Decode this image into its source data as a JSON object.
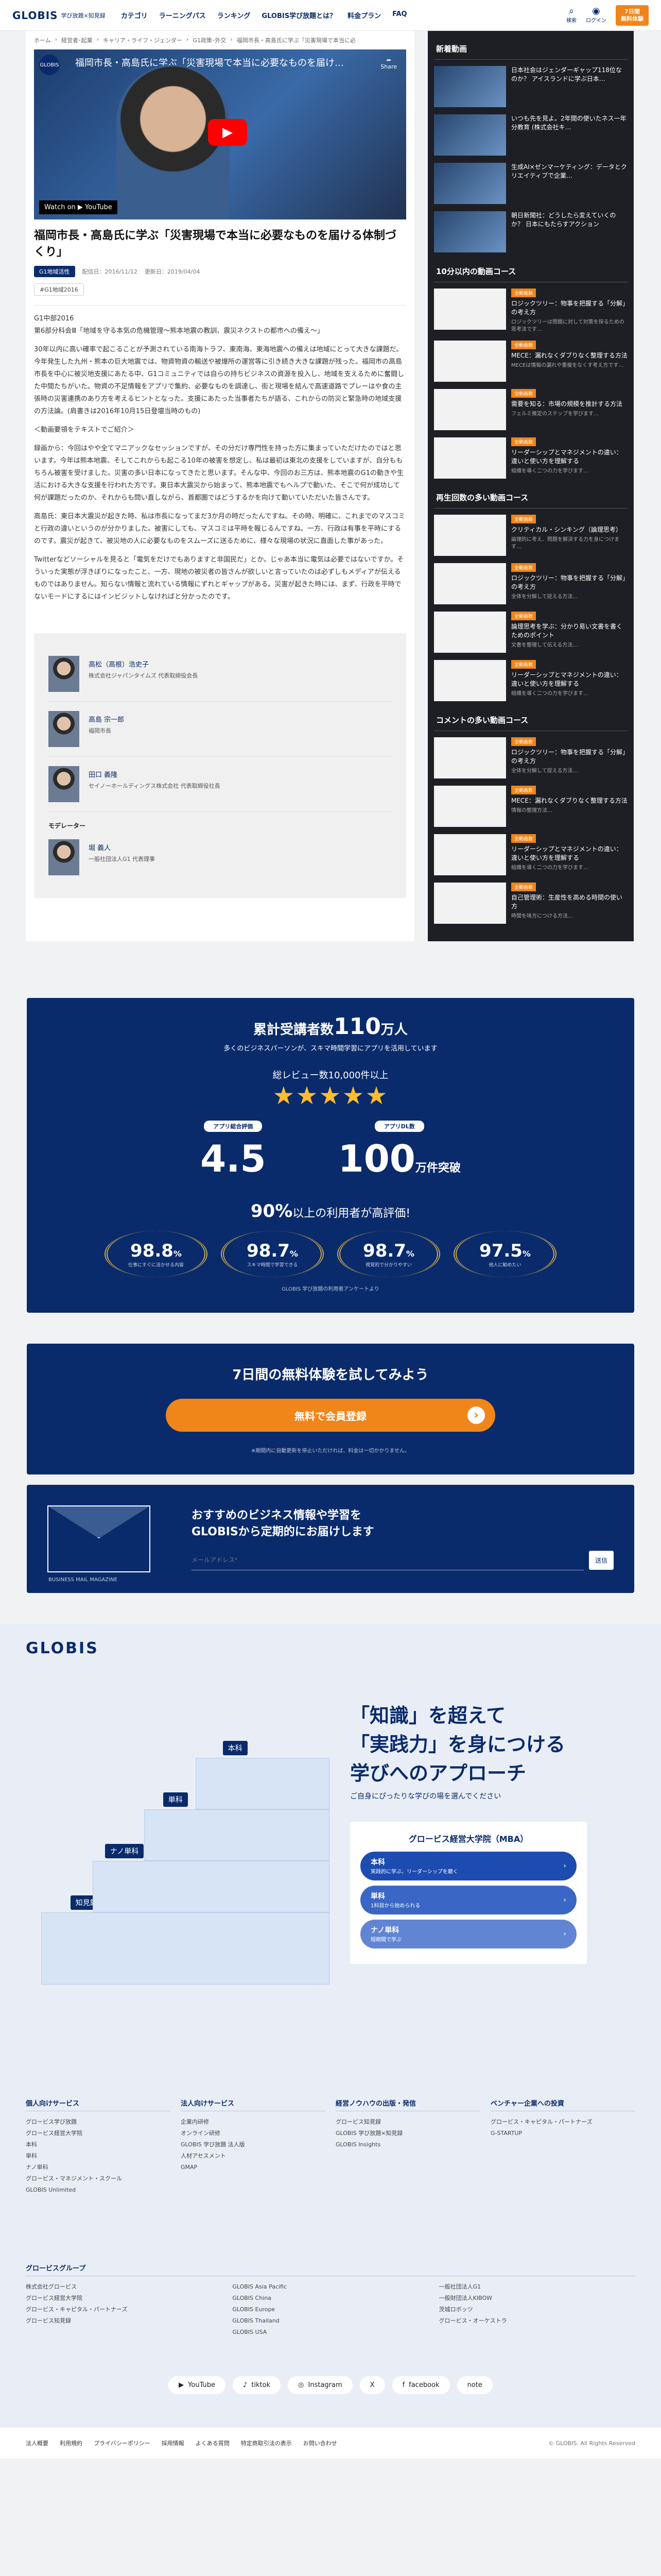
{
  "header": {
    "logo": "GLOBIS",
    "logo_sub": "学び放題×知見録",
    "nav": [
      "カテゴリ",
      "ラーニングパス",
      "ランキング",
      "GLOBIS学び放題とは？",
      "料金プラン",
      "FAQ"
    ],
    "icons": [
      {
        "glyph": "⌕",
        "label": "検索"
      },
      {
        "glyph": "◉",
        "label": "ログイン"
      }
    ],
    "trial_line1": "7日間",
    "trial_line2": "無料体験"
  },
  "breadcrumb": [
    "ホーム",
    "経営者･起業",
    "キャリア・ライフ・ジェンダー",
    "G1政策･外交",
    "福岡市長・高島氏に学ぶ「災害現場で本当に必要なものを届ける体制づくり」"
  ],
  "video": {
    "channel": "GLOBIS",
    "title": "福岡市長・高島氏に学ぶ「災害現場で本当に必要なものを届け…",
    "share": "Share",
    "watch": "Watch on ▶ YouTube"
  },
  "article": {
    "title": "福岡市長・高島氏に学ぶ「災害現場で本当に必要なものを届ける体制づくり」",
    "tag": "G1地域活性",
    "published": "配信日：2016/11/12",
    "updated": "更新日：2019/04/04",
    "subtag": "#G1地域2016",
    "paragraphs": [
      "G1中部2016\n第6部分科会Ⅲ「地域を守る本気の危機管理～熊本地震の教訓、震災ネクストの都市への備え～」",
      "30年以内に高い確率で起こることが予測されている南海トラフ、東南海、東海地震への備えは地域にとって大きな課題だ。今年発生した九州・熊本の巨大地震では、物資物資の輸送や被爆所の運営等に引き続き大きな課題が残った。福岡市の高島市長を中心に被災地支援にあたる中、G1コミュニティでは自らの持ちビジネスの資源を投入し、地域を支えるために奮闘した中間たちがいた。物資の不足情報をアプリで集約、必要なものを調達し、街と現場を結んで高速道路でプレーはや食の主張時の災害連携のあり方を考えるヒントとなった。支援にあたった当事者たちが語る、これからの防災と緊急時の地域支援の方法論。(肩書きは2016年10月15日登壇当時のもの)",
      "＜動画要領をテキストでご紹介＞",
      "録画から：今回はやや全てマニアックなセッションですが、その分だけ専門性を持った方に集まっていただけたのではと思います。今年は熊本地震、そしてこれからも起こる10年の被害を想定し、私は最初は東北の支援をしていますが、自分ももちろん被害を受けました。災害の多い日本になってきたと思います。そんな中、今回のお三方は、熊本地震のG1の動きや生活における大きな支援を行われた方です。東日本大震災から始まって、熊本地震でもヘルプで動いた、そこで何が成功して何が課題だったのか、それからも問い直しながら、首都圏ではどうするかを向けて動いていただいた皆さんです。",
      "高島氏：東日本大震災が起きた時、私は市長になってまだ3か月の時だったんですね。その時、明確に、これまでのマスコミと行政の違いというのが分かりました。被害にしても、マスコミは平時を報じるんですね。一方、行政は有事を平時にするのです。震災が起きて、被災地の人に必要なものをスムーズに送るために、様々な現場の状況に直面した事があった。",
      "Twitterなどソーシャルを見ると「電気をだけでもありますと非国民だ」とか。じゃあ本当に電気は必要ではないですか。そういった実態が浮きぼりになったこと、一方、現地の被災者の皆さんが欲しいと言っていたのは必ずしもメディアが伝えるものではありません。知らない情報と流れている情報にずれとギャップがある。災害が起きた時には、まず、行政を平時でないモードにするにはインビジットしなければと分かったのです。"
    ]
  },
  "speakers": [
    {
      "name": "高松（高根）浩史子",
      "role": "株式会社ジャパンタイムズ 代表取締役会長"
    },
    {
      "name": "高島 宗一郎",
      "role": "福岡市長"
    },
    {
      "name": "田口 義隆",
      "role": "セイノーホールディングス株式会社 代表取締役社長"
    }
  ],
  "moderator_label": "モデレーター",
  "moderator": {
    "name": "堀 義人",
    "role": "一般社団法人G1 代表理事"
  },
  "sidebar": {
    "new_heading": "新着動画",
    "new_items": [
      {
        "title": "日本社会はジェンダーギャップ118位なのか？ アイスランドに学ぶ日本…"
      },
      {
        "title": "いつも先を見よ。2年間の使いたネス一年分教育 (株式会社キ…"
      },
      {
        "title": "生成AI×ゼンマーケティング：データとクリエイティブで企業…"
      },
      {
        "title": "朝日新聞社：どうしたら変えていくのか？ 日本にもたらすアクション"
      }
    ],
    "short_heading": "10分以内の動画コース",
    "short_items": [
      {
        "badge": "全動画数",
        "title": "ロジックツリー：物事を把握する「分解」の考え方",
        "desc": "ロジックツリーは問題に対して対策を探るための思考法です…"
      },
      {
        "badge": "全動画数",
        "title": "MECE：漏れなくダブりなく整理する方法",
        "desc": "MECEは情報の漏れや重複をなくす考え方です…"
      },
      {
        "badge": "全動画数",
        "title": "需要を知る：市場の規模を推計する方法",
        "desc": "フェルミ推定のステップを学びます…"
      },
      {
        "badge": "全動画数",
        "title": "リーダーシップとマネジメントの違い：違いと使い方を理解する",
        "desc": "組織を導く二つの力を学びます…"
      }
    ],
    "replay_heading": "再生回数の多い動画コース",
    "replay_items": [
      {
        "badge": "全動画数",
        "title": "クリティカル・シンキング（論理思考）",
        "desc": "論理的に考え、問題を解決する力を身につけます…"
      },
      {
        "badge": "全動画数",
        "title": "ロジックツリー：物事を把握する「分解」の考え方",
        "desc": "全体を分解して捉える方法…"
      },
      {
        "badge": "全動画数",
        "title": "論理思考を学ぶ：分かり易い文書を書くためのポイント",
        "desc": "文書を整理して伝える方法…"
      },
      {
        "badge": "全動画数",
        "title": "リーダーシップとマネジメントの違い：違いと使い方を理解する",
        "desc": "組織を導く二つの力を学びます…"
      }
    ],
    "comment_heading": "コメントの多い動画コース",
    "comment_items": [
      {
        "badge": "全動画数",
        "title": "ロジックツリー：物事を把握する「分解」の考え方",
        "desc": "全体を分解して捉える方法…"
      },
      {
        "badge": "全動画数",
        "title": "MECE：漏れなくダブりなく整理する方法",
        "desc": "情報の整理方法…"
      },
      {
        "badge": "全動画数",
        "title": "リーダーシップとマネジメントの違い：違いと使い方を理解する",
        "desc": "組織を導く二つの力を学びます…"
      },
      {
        "badge": "全動画数",
        "title": "自己管理術：生産性を高める時間の使い方",
        "desc": "時間を味方につける方法…"
      }
    ]
  },
  "stats": {
    "title_pre": "累計受講者数",
    "title_num": "110",
    "title_post": "万人",
    "sub": "多くのビジネスパーソンが、スキマ時間学習にアプリを活用しています",
    "review": "総レビュー数10,000件以上",
    "stars": "★★★★★",
    "app_rating_label": "アプリ総合評価",
    "app_rating": "4.5",
    "app_dl_label": "アプリDL数",
    "app_dl": "100",
    "app_dl_unit": "万件突破",
    "satis_pre": "90%",
    "satis_post": "以上の利用者が高評価!",
    "laurels": [
      {
        "pct": "98.8",
        "desc": "仕事にすぐに活かせる内容"
      },
      {
        "pct": "98.7",
        "desc": "スキマ時間で学習できる"
      },
      {
        "pct": "98.7",
        "desc": "視覚的で分かりやすい"
      },
      {
        "pct": "97.5",
        "desc": "他人に勧めたい"
      }
    ],
    "note": "GLOBIS 学び放題の利用者アンケートより"
  },
  "trial": {
    "heading": "7日間の無料体験を試してみよう",
    "cta": "無料で会員登録",
    "fine": "※期間内に自動更新を停止いただければ、料金は一切かかりません。"
  },
  "mail": {
    "magazine": "BUSINESS MAIL MAGAZINE",
    "heading_1": "おすすめのビジネス情報や学習を",
    "heading_2": "GLOBISから定期的にお届けします",
    "placeholder": "メールアドレス*",
    "submit": "送信"
  },
  "footer": {
    "logo": "GLOBIS",
    "hero_1": "「知識」を超えて",
    "hero_2": "「実践力」を身につける",
    "hero_3": "学びへのアプローチ",
    "hero_sub": "ご自身にぴったりな学びの場を選んでください",
    "mba_title": "グロービス経営大学院（MBA）",
    "mba_buttons": [
      {
        "t": "本科",
        "s": "実践的に学ぶ、リーダーシップを磨く"
      },
      {
        "t": "単科",
        "s": "1科目から始められる"
      },
      {
        "t": "ナノ単科",
        "s": "短期間で学ぶ"
      }
    ],
    "stairs": [
      "知見録",
      "ナノ単科",
      "単科",
      "本科"
    ],
    "cols": [
      {
        "h": "個人向けサービス",
        "items": [
          "グロービス学び放題",
          "グロービス経営大学院",
          "本科",
          "単科",
          "ナノ単科",
          "グロービス・マネジメント・スクール",
          "GLOBIS Unlimited"
        ]
      },
      {
        "h": "法人向けサービス",
        "items": [
          "企業内研修",
          "オンライン研修",
          "GLOBIS 学び放題 法人版",
          "人材アセスメント",
          "GMAP"
        ]
      },
      {
        "h": "経営ノウハウの出版・発信",
        "items": [
          "グロービス知見録",
          "GLOBIS 学び放題×知見録",
          "GLOBIS Insights"
        ]
      },
      {
        "h": "ベンチャー企業への投資",
        "items": [
          "グロービス・キャピタル・パートナーズ",
          "G-STARTUP"
        ]
      }
    ],
    "group_h": "グロービスグループ",
    "group_cols": [
      [
        "株式会社グロービス",
        "グロービス経営大学院",
        "グロービス・キャピタル・パートナーズ",
        "グロービス知見録"
      ],
      [
        "GLOBIS Asia Pacific",
        "GLOBIS China",
        "GLOBIS Europe",
        "GLOBIS Thailand",
        "GLOBIS USA"
      ],
      [
        "一般社団法人G1",
        "一般財団法人KIBOW",
        "茨城ロボッツ",
        "グロービス・オーケストラ"
      ]
    ],
    "social": [
      "YouTube",
      "tiktok",
      "Instagram",
      "X",
      "facebook",
      "note"
    ],
    "links": [
      "法人概要",
      "利用規約",
      "プライバシーポリシー",
      "採用情報",
      "よくある質問",
      "特定商取引法の表示",
      "お問い合わせ"
    ],
    "copyright": "© GLOBIS. All Rights Reserved"
  }
}
